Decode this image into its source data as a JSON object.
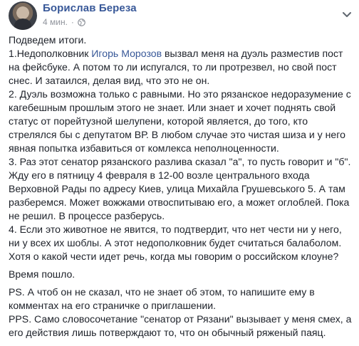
{
  "post": {
    "author": "Борислав Береза",
    "time": "4 мин.",
    "separator": "·",
    "paragraphs": {
      "p1": "Подведем итоги.",
      "p2a": "1.Недополковник ",
      "p2_mention": "Игорь Морозов",
      "p2b": " вызвал меня на дуэль разместив пост на фейсбуке. А потом то ли испугался, то ли протрезвел, но свой пост снес. И затаился, делая вид, что это не он.",
      "p3": "2. Дуэль возможна только с равными. Но это рязанское недоразумение с кагебешным прошлым этого не знает. Или знает и хочет поднять свой статус от порейтузной шелупени, которой является, до того, кто стрелялся бы с депутатом ВР. В любом случае это чистая шиза и у него явная попытка избавиться от комлекса неполноценности.",
      "p4": "3. Раз этот сенатор рязанского разлива сказал \"а\", то пусть говорит и \"б\". Жду его в пятницу 4 февраля в 12-00 возле центрального входа Верховной Рады по адресу Киев, улица Михайла Грушевського 5. А там разберемся. Может вожжами отвоспитываю его, а может оглоблей. Пока не решил. В процессе разберусь.",
      "p5": "4. Если это животное не явится, то подтвердит, что нет чести ни у него, ни у всех их шоблы. А этот недополковник будет считаться балаболом. Хотя о какой чести идет речь, когда мы говорим о российском клоуне?",
      "p6": "Время пошло.",
      "p7": "PS. А чтоб он не сказал, что не знает об этом, то напишите ему в комментах на его страничке о приглашении.",
      "p8": "PPS. Само словосочетание \"сенатор от Рязани\" вызывает у меня смех, а его действия лишь потверждают то, что он обычный ряженый паяц."
    }
  },
  "icons": {
    "privacy": "globe-icon",
    "menu": "chevron-down-icon",
    "avatar": "profile-photo"
  },
  "colors": {
    "link": "#385898",
    "text": "#1d2129",
    "meta": "#90949c"
  }
}
